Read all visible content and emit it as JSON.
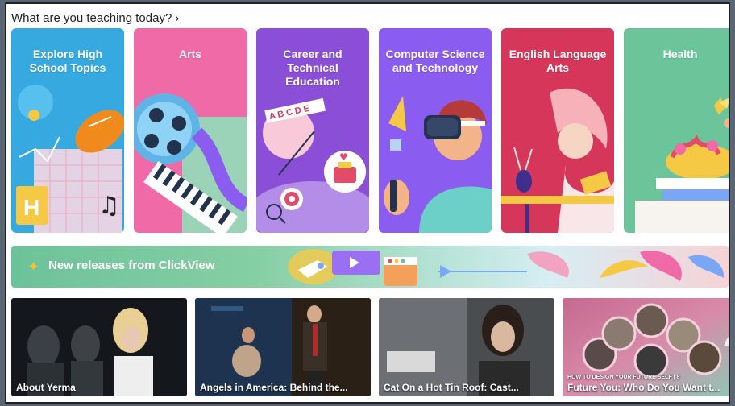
{
  "section": {
    "heading": "What are you teaching today?",
    "heading_chevron_icon": "chevron-right-icon"
  },
  "subjects": [
    {
      "label": "Explore High School Topics",
      "color": "#36a9e1"
    },
    {
      "label": "Arts",
      "color": "#f06aa8"
    },
    {
      "label": "Career and Technical Education",
      "color": "#8a4fd6"
    },
    {
      "label": "Computer Science and Technology",
      "color": "#8a5cf0"
    },
    {
      "label": "English Language Arts",
      "color": "#d6365a"
    },
    {
      "label": "Health",
      "color": "#6cc49a"
    }
  ],
  "banner": {
    "icon": "sparkle-icon",
    "label": "New releases from ClickView"
  },
  "videos": [
    {
      "kicker": "",
      "caption": "About Yerma"
    },
    {
      "kicker": "",
      "caption": "Angels in America: Behind the..."
    },
    {
      "kicker": "",
      "caption": "Cat On a Hot Tin Roof: Cast..."
    },
    {
      "kicker": "HOW TO DESIGN YOUR FUTURE SELF | 8",
      "caption": "Future You: Who Do You Want t..."
    }
  ]
}
